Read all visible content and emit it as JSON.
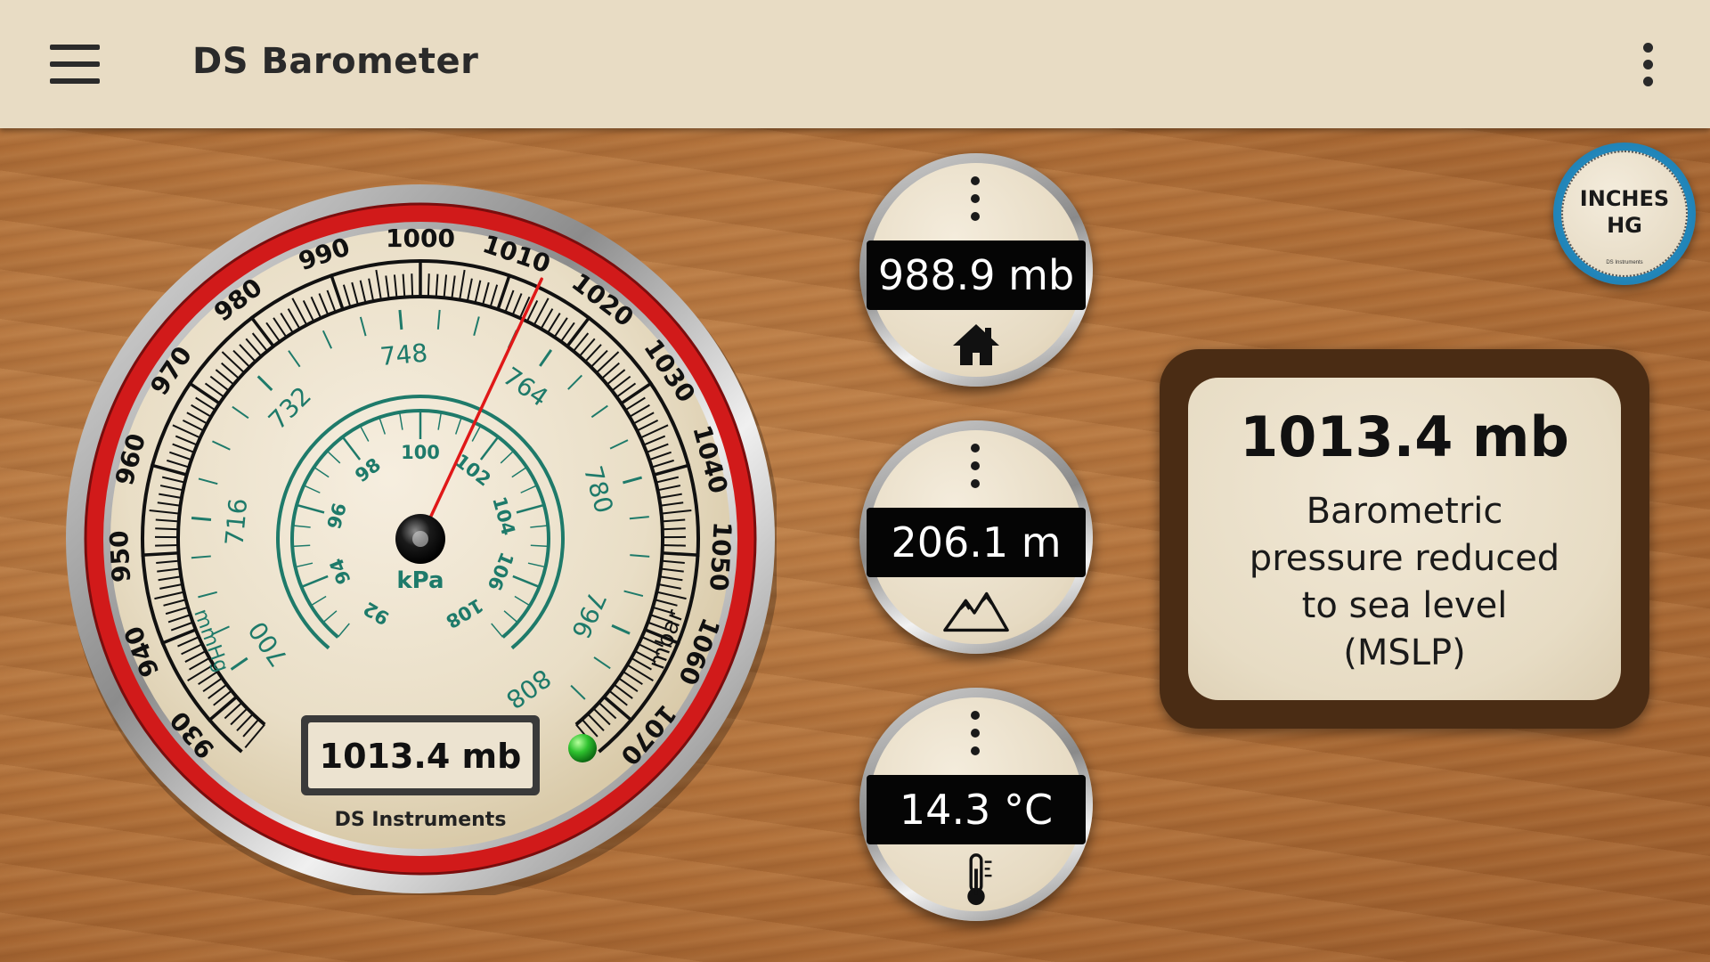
{
  "app": {
    "title": "DS Barometer"
  },
  "gauge": {
    "mbar": {
      "unit": "mbar",
      "ticks": [
        "930",
        "940",
        "950",
        "960",
        "970",
        "980",
        "990",
        "1000",
        "1010",
        "1020",
        "1030",
        "1040",
        "1050",
        "1060",
        "1070"
      ],
      "min": 925,
      "max": 1075
    },
    "mmhg": {
      "unit": "mmHg",
      "ticks": [
        "700",
        "716",
        "732",
        "748",
        "764",
        "780",
        "796",
        "808"
      ]
    },
    "kpa": {
      "unit": "kPa",
      "ticks": [
        "92",
        "94",
        "96",
        "98",
        "100",
        "102",
        "104",
        "106",
        "108"
      ]
    },
    "needle_value_mbar": 1013.4,
    "readout": "1013.4 mb",
    "brand": "DS Instruments",
    "status_color": "#2fc22f"
  },
  "mini_gauges": [
    {
      "value": "988.9 mb",
      "icon": "home-icon"
    },
    {
      "value": "206.1 m",
      "icon": "mountain-icon"
    },
    {
      "value": "14.3 °C",
      "icon": "thermometer-icon"
    }
  ],
  "units_button": {
    "label_line1": "INCHES",
    "label_line2": "HG",
    "brand": "DS Instruments"
  },
  "info": {
    "value": "1013.4 mb",
    "desc_line1": "Barometric",
    "desc_line2": "pressure reduced",
    "desc_line3": "to sea level",
    "desc_line4": "(MSLP)"
  },
  "colors": {
    "bezel_red": "#d11a1a",
    "scale_green": "#1e7a6a",
    "needle": "#e01818",
    "appbar": "#e8dcc4"
  }
}
